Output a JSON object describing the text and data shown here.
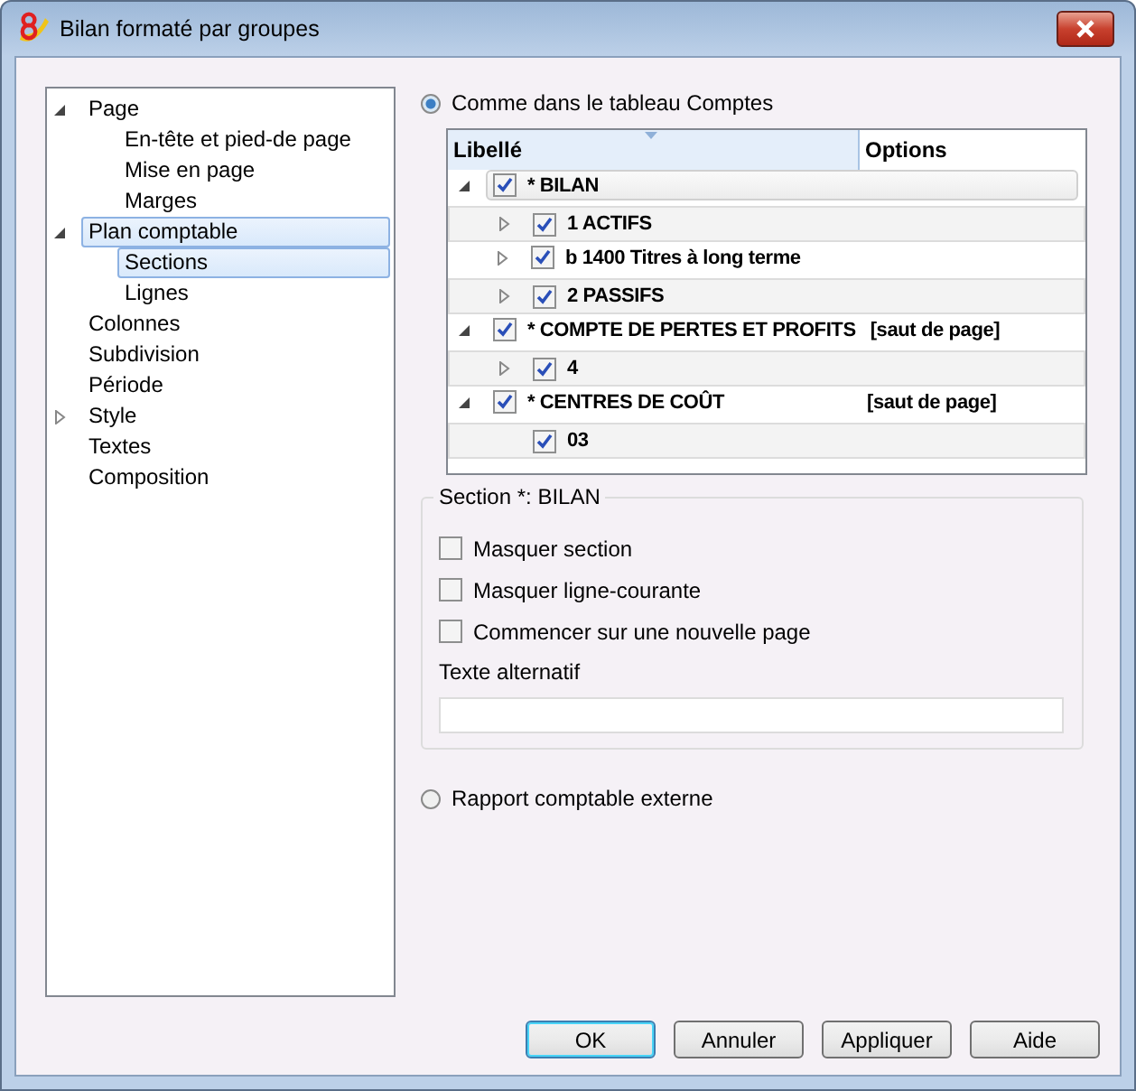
{
  "window": {
    "title": "Bilan formaté par groupes"
  },
  "nav": [
    {
      "label": "Page",
      "expanded": true,
      "selected": false,
      "children": [
        {
          "label": "En-tête et pied-de page",
          "selected": false
        },
        {
          "label": "Mise en page",
          "selected": false
        },
        {
          "label": "Marges",
          "selected": false
        }
      ]
    },
    {
      "label": "Plan comptable",
      "expanded": true,
      "selected": true,
      "children": [
        {
          "label": "Sections",
          "selected": true
        },
        {
          "label": "Lignes",
          "selected": false
        }
      ]
    },
    {
      "label": "Colonnes",
      "selected": false
    },
    {
      "label": "Subdivision",
      "selected": false
    },
    {
      "label": "Période",
      "selected": false
    },
    {
      "label": "Style",
      "expanded": false,
      "selected": false
    },
    {
      "label": "Textes",
      "selected": false
    },
    {
      "label": "Composition",
      "selected": false
    }
  ],
  "source_options": [
    {
      "label": "Comme dans le tableau Comptes",
      "selected": true
    },
    {
      "label": "Rapport comptable externe",
      "selected": false
    }
  ],
  "table": {
    "columns": [
      "Libellé",
      "Options"
    ],
    "rows": [
      {
        "label": "* BILAN",
        "checked": true,
        "expanded": true,
        "selected": true,
        "children": [
          {
            "label": "1 ACTIFS",
            "checked": true,
            "expanded": false,
            "selected": false
          },
          {
            "label": "b 1400 Titres à long terme",
            "checked": true,
            "expanded": false,
            "selected": false
          },
          {
            "label": "2 PASSIFS",
            "checked": true,
            "expanded": false,
            "selected": false
          }
        ]
      },
      {
        "label": "* COMPTE DE PERTES ET PROFITS",
        "options": "[saut de page]",
        "checked": true,
        "expanded": true,
        "selected": false,
        "children": [
          {
            "label": "4",
            "checked": true,
            "expanded": false,
            "selected": false
          }
        ]
      },
      {
        "label": "* CENTRES DE COÛT",
        "options": "[saut de page]",
        "checked": true,
        "expanded": true,
        "selected": false,
        "children": [
          {
            "label": "03",
            "checked": true,
            "selected": false
          }
        ]
      }
    ]
  },
  "section": {
    "title": "Section *: BILAN",
    "checkboxes": [
      {
        "label": "Masquer section",
        "checked": false
      },
      {
        "label": "Masquer ligne-courante",
        "checked": false
      },
      {
        "label": "Commencer sur une nouvelle page",
        "checked": false
      }
    ],
    "alt_text_label": "Texte alternatif"
  },
  "buttons": [
    {
      "label": "OK",
      "default": true
    },
    {
      "label": "Annuler",
      "default": false
    },
    {
      "label": "Appliquer",
      "default": false
    },
    {
      "label": "Aide",
      "default": false
    }
  ]
}
